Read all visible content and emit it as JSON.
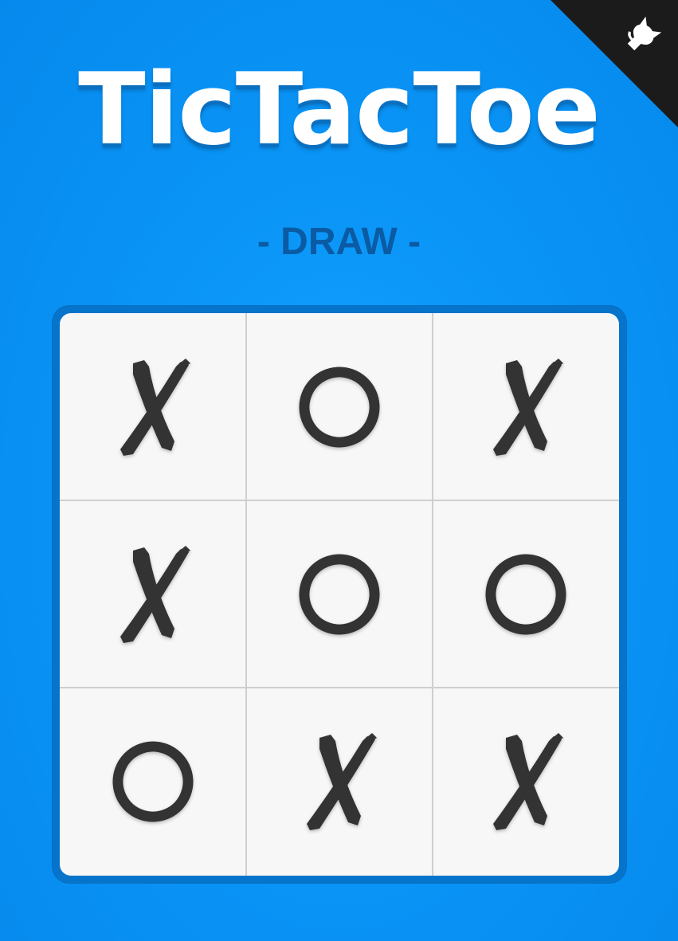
{
  "app": {
    "title": "TicTacToe",
    "status": "- DRAW -"
  },
  "corner_badge": {
    "icon": "github-octocat-icon",
    "background": "#1b1b1b",
    "icon_color": "#ffffff"
  },
  "colors": {
    "background": "#0a95f7",
    "title_text": "#ffffff",
    "status_text": "#0a5ba3",
    "board_frame": "#0774cc",
    "board_surface": "#f7f7f7",
    "grid_line": "#cfcfcf",
    "mark_color": "#333333"
  },
  "board": {
    "cells": [
      {
        "row": 0,
        "col": 0,
        "mark": "X"
      },
      {
        "row": 0,
        "col": 1,
        "mark": "O"
      },
      {
        "row": 0,
        "col": 2,
        "mark": "X"
      },
      {
        "row": 1,
        "col": 0,
        "mark": "X"
      },
      {
        "row": 1,
        "col": 1,
        "mark": "O"
      },
      {
        "row": 1,
        "col": 2,
        "mark": "O"
      },
      {
        "row": 2,
        "col": 0,
        "mark": "O"
      },
      {
        "row": 2,
        "col": 1,
        "mark": "X"
      },
      {
        "row": 2,
        "col": 2,
        "mark": "X"
      }
    ]
  }
}
